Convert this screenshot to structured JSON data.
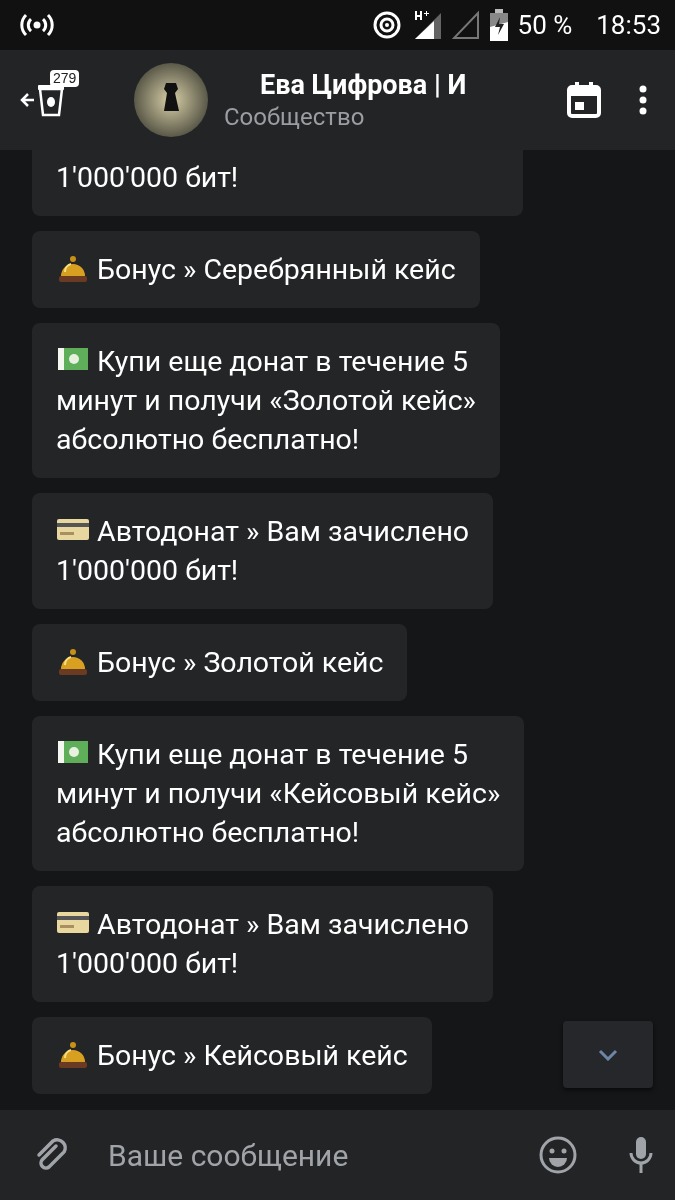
{
  "status_bar": {
    "battery": "50 %",
    "time": "18:53"
  },
  "header": {
    "unread_count": "279",
    "title": "Ева Цифрова | И",
    "subtitle": "Сообщество"
  },
  "messages": [
    {
      "kind": "continued",
      "text": "1'000'000 бит!"
    },
    {
      "kind": "bonus",
      "text": "Бонус » Серебрянный кейс"
    },
    {
      "kind": "offer",
      "text": "Купи еще донат в течение 5\nминут и получи «Золотой кейс»\nабсолютно бесплатно!"
    },
    {
      "kind": "autodonate",
      "text": "Автодонат » Вам зачислено\n1'000'000 бит!"
    },
    {
      "kind": "bonus",
      "text": "Бонус » Золотой кейс"
    },
    {
      "kind": "offer",
      "text": "Купи еще донат в течение 5\nминут и получи «Кейсовый кейс»\nабсолютно бесплатно!"
    },
    {
      "kind": "autodonate",
      "text": "Автодонат » Вам зачислено\n1'000'000 бит!"
    },
    {
      "kind": "bonus",
      "text": "Бонус » Кейсовый кейс"
    }
  ],
  "composer": {
    "placeholder": "Ваше сообщение"
  }
}
